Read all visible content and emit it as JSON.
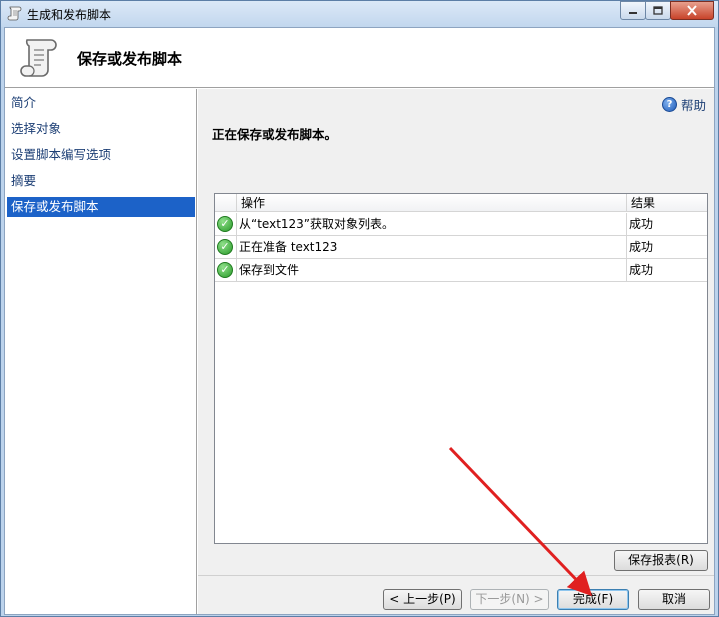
{
  "window": {
    "title": "生成和发布脚本",
    "icon": "script-scroll-icon",
    "controls": [
      "minimize-icon",
      "maximize-icon",
      "close-icon"
    ]
  },
  "header": {
    "title": "保存或发布脚本",
    "icon": "script-scroll-icon"
  },
  "nav": {
    "items": [
      {
        "label": "简介",
        "active": false
      },
      {
        "label": "选择对象",
        "active": false
      },
      {
        "label": "设置脚本编写选项",
        "active": false
      },
      {
        "label": "摘要",
        "active": false
      },
      {
        "label": "保存或发布脚本",
        "active": true
      }
    ]
  },
  "main": {
    "help_label": "帮助",
    "heading": "正在保存或发布脚本。",
    "grid": {
      "columns": [
        "操作",
        "结果"
      ],
      "rows": [
        {
          "status_icon": "success-check-icon",
          "action": "从“text123”获取对象列表。",
          "result": "成功"
        },
        {
          "status_icon": "success-check-icon",
          "action": "正在准备 text123",
          "result": "成功"
        },
        {
          "status_icon": "success-check-icon",
          "action": "保存到文件",
          "result": "成功"
        }
      ]
    },
    "save_report_label": "保存报表(R)"
  },
  "footer": {
    "prev_label": "< 上一步(P)",
    "next_label": "下一步(N) >",
    "finish_label": "完成(F)",
    "cancel_label": "取消"
  },
  "annotation": {
    "type": "red-arrow",
    "color": "#e02020",
    "points_to": "finish-button"
  }
}
